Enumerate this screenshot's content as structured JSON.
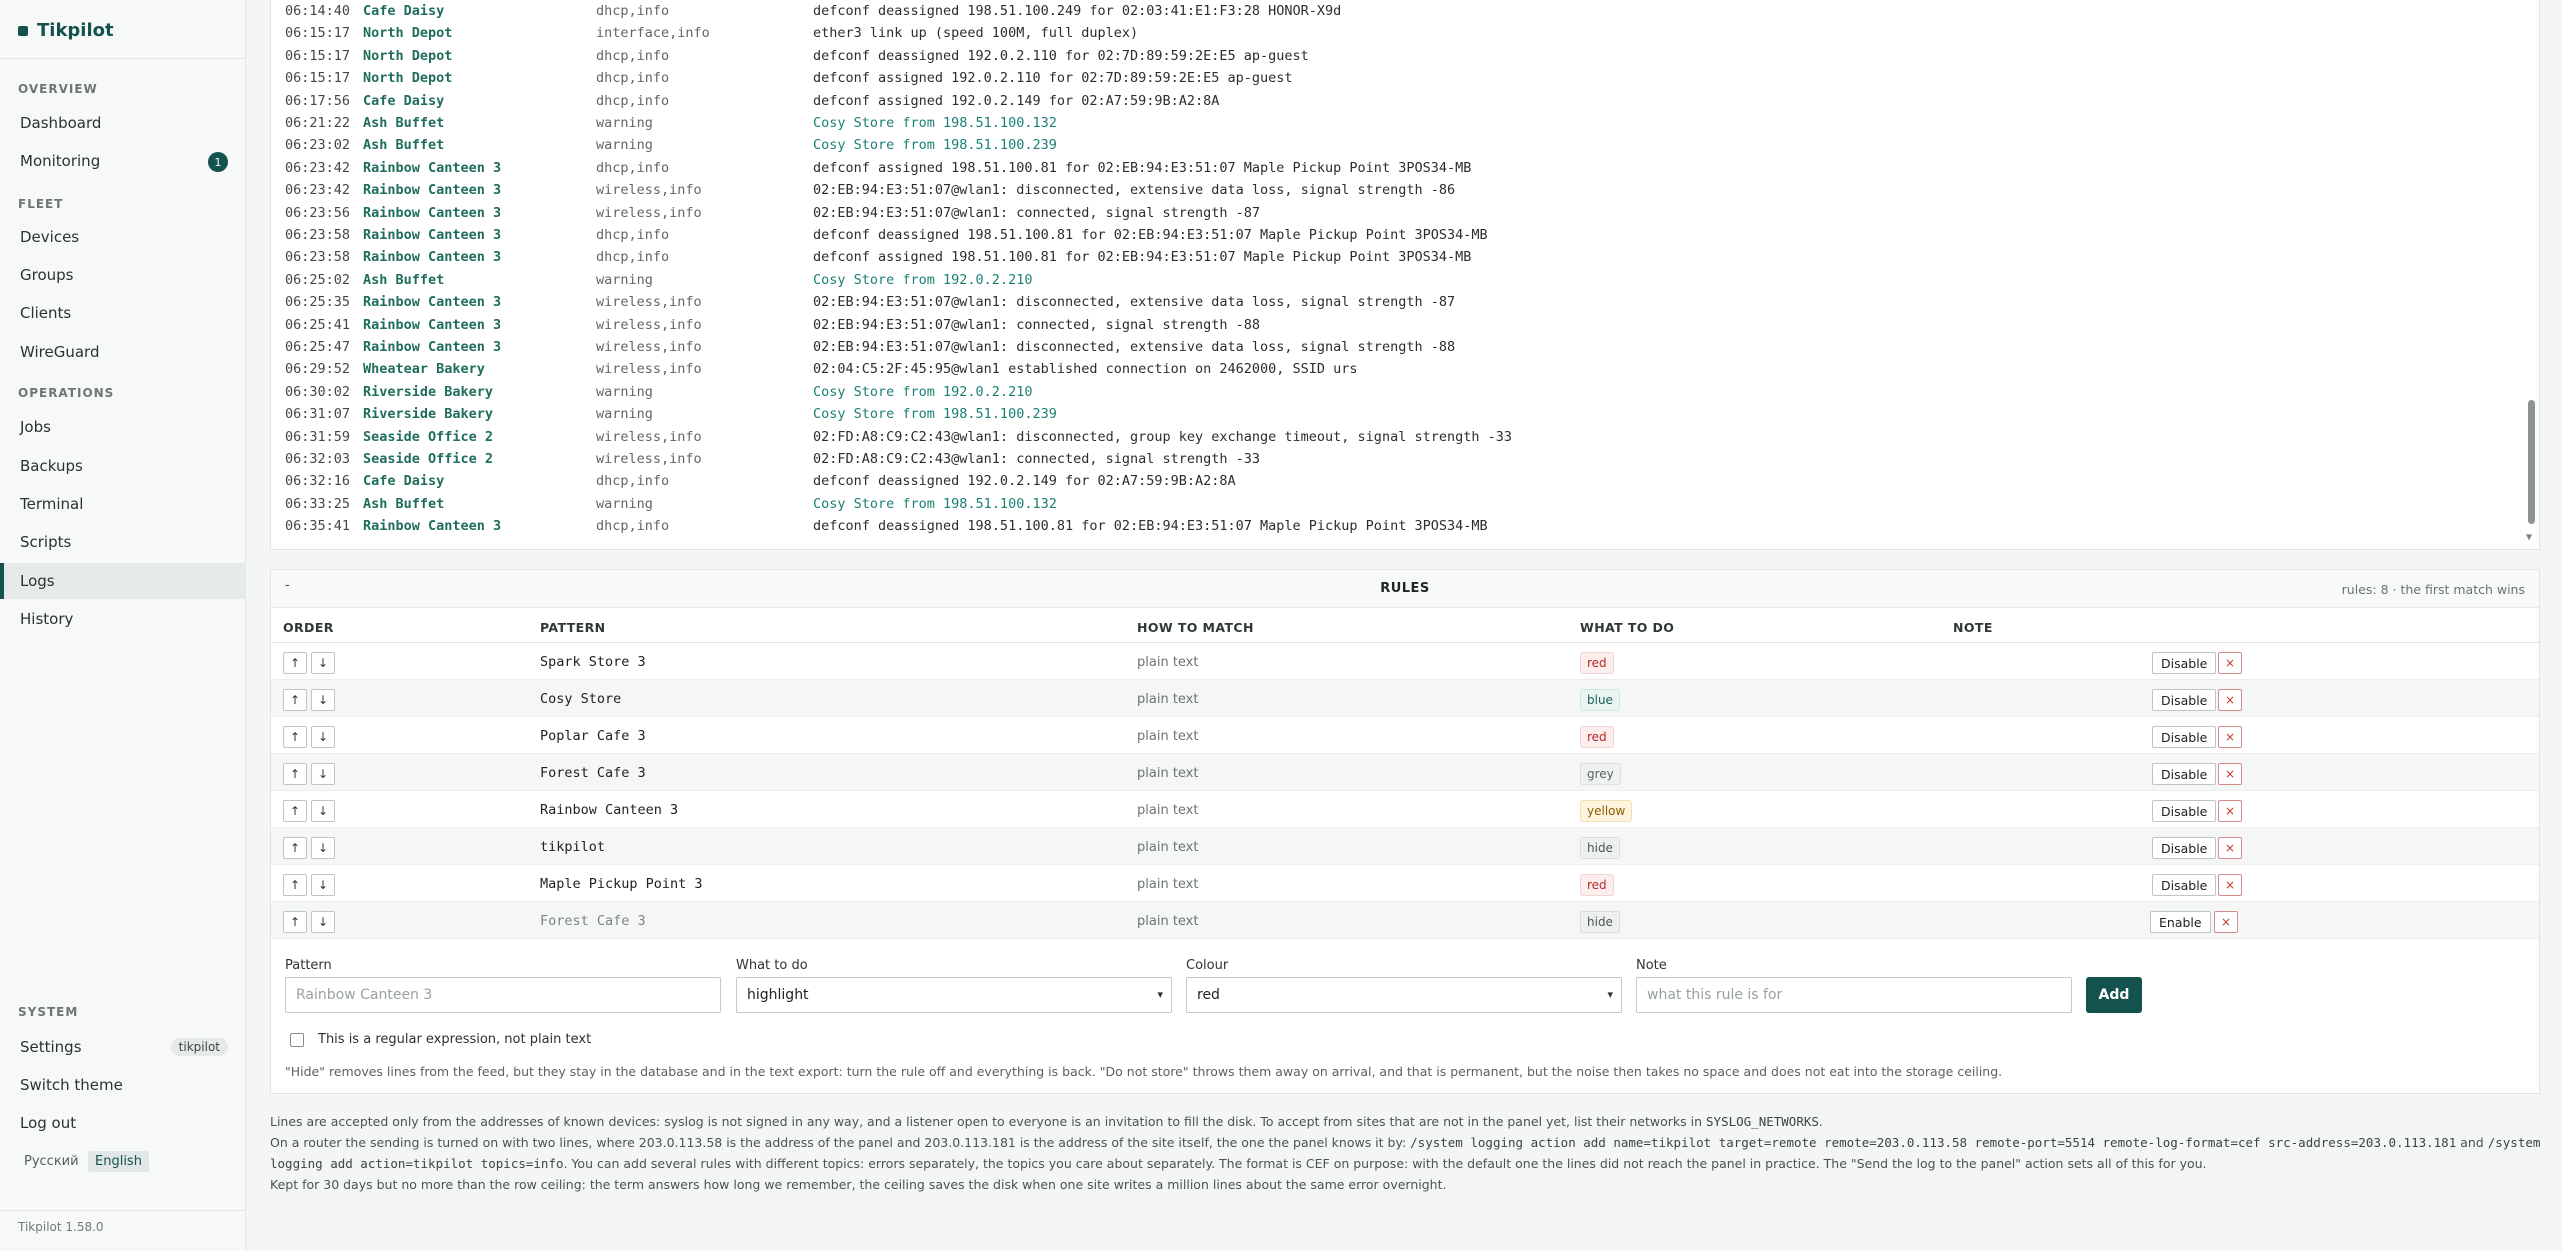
{
  "app": {
    "name": "Tikpilot",
    "version": "Tikpilot 1.58.0"
  },
  "sidebar": {
    "sections": {
      "overview": "OVERVIEW",
      "fleet": "FLEET",
      "operations": "OPERATIONS",
      "system": "SYSTEM"
    },
    "items": {
      "dashboard": "Dashboard",
      "monitoring": "Monitoring",
      "monitoring_badge": "1",
      "devices": "Devices",
      "groups": "Groups",
      "clients": "Clients",
      "wireguard": "WireGuard",
      "jobs": "Jobs",
      "backups": "Backups",
      "terminal": "Terminal",
      "scripts": "Scripts",
      "logs": "Logs",
      "history": "History",
      "settings": "Settings",
      "settings_user": "tikpilot",
      "switch_theme": "Switch theme",
      "log_out": "Log out"
    },
    "languages": {
      "ru": "Русский",
      "en": "English"
    }
  },
  "log": [
    {
      "time": "06:14:40",
      "device": "Cafe Daisy",
      "topics": "dhcp,info",
      "message": "defconf deassigned 198.51.100.249 for 02:03:41:E1:F3:28 HONOR-X9d",
      "highlight": false
    },
    {
      "time": "06:15:17",
      "device": "North Depot",
      "topics": "interface,info",
      "message": "ether3 link up (speed 100M, full duplex)",
      "highlight": false
    },
    {
      "time": "06:15:17",
      "device": "North Depot",
      "topics": "dhcp,info",
      "message": "defconf deassigned 192.0.2.110 for 02:7D:89:59:2E:E5 ap-guest",
      "highlight": false
    },
    {
      "time": "06:15:17",
      "device": "North Depot",
      "topics": "dhcp,info",
      "message": "defconf assigned 192.0.2.110 for 02:7D:89:59:2E:E5 ap-guest",
      "highlight": false
    },
    {
      "time": "06:17:56",
      "device": "Cafe Daisy",
      "topics": "dhcp,info",
      "message": "defconf assigned 192.0.2.149 for 02:A7:59:9B:A2:8A",
      "highlight": false
    },
    {
      "time": "06:21:22",
      "device": "Ash Buffet",
      "topics": "warning",
      "message": "Cosy Store from 198.51.100.132",
      "highlight": true
    },
    {
      "time": "06:23:02",
      "device": "Ash Buffet",
      "topics": "warning",
      "message": "Cosy Store from 198.51.100.239",
      "highlight": true
    },
    {
      "time": "06:23:42",
      "device": "Rainbow Canteen 3",
      "topics": "dhcp,info",
      "message": "defconf assigned 198.51.100.81 for 02:EB:94:E3:51:07 Maple Pickup Point 3POS34-MB",
      "highlight": false
    },
    {
      "time": "06:23:42",
      "device": "Rainbow Canteen 3",
      "topics": "wireless,info",
      "message": "02:EB:94:E3:51:07@wlan1: disconnected, extensive data loss, signal strength -86",
      "highlight": false
    },
    {
      "time": "06:23:56",
      "device": "Rainbow Canteen 3",
      "topics": "wireless,info",
      "message": "02:EB:94:E3:51:07@wlan1: connected, signal strength -87",
      "highlight": false
    },
    {
      "time": "06:23:58",
      "device": "Rainbow Canteen 3",
      "topics": "dhcp,info",
      "message": "defconf deassigned 198.51.100.81 for 02:EB:94:E3:51:07 Maple Pickup Point 3POS34-MB",
      "highlight": false
    },
    {
      "time": "06:23:58",
      "device": "Rainbow Canteen 3",
      "topics": "dhcp,info",
      "message": "defconf assigned 198.51.100.81 for 02:EB:94:E3:51:07 Maple Pickup Point 3POS34-MB",
      "highlight": false
    },
    {
      "time": "06:25:02",
      "device": "Ash Buffet",
      "topics": "warning",
      "message": "Cosy Store from 192.0.2.210",
      "highlight": true
    },
    {
      "time": "06:25:35",
      "device": "Rainbow Canteen 3",
      "topics": "wireless,info",
      "message": "02:EB:94:E3:51:07@wlan1: disconnected, extensive data loss, signal strength -87",
      "highlight": false
    },
    {
      "time": "06:25:41",
      "device": "Rainbow Canteen 3",
      "topics": "wireless,info",
      "message": "02:EB:94:E3:51:07@wlan1: connected, signal strength -88",
      "highlight": false
    },
    {
      "time": "06:25:47",
      "device": "Rainbow Canteen 3",
      "topics": "wireless,info",
      "message": "02:EB:94:E3:51:07@wlan1: disconnected, extensive data loss, signal strength -88",
      "highlight": false
    },
    {
      "time": "06:29:52",
      "device": "Wheatear Bakery",
      "topics": "wireless,info",
      "message": "02:04:C5:2F:45:95@wlan1 established connection on 2462000, SSID urs",
      "highlight": false
    },
    {
      "time": "06:30:02",
      "device": "Riverside Bakery",
      "topics": "warning",
      "message": "Cosy Store from 192.0.2.210",
      "highlight": true
    },
    {
      "time": "06:31:07",
      "device": "Riverside Bakery",
      "topics": "warning",
      "message": "Cosy Store from 198.51.100.239",
      "highlight": true
    },
    {
      "time": "06:31:59",
      "device": "Seaside Office 2",
      "topics": "wireless,info",
      "message": "02:FD:A8:C9:C2:43@wlan1: disconnected, group key exchange timeout, signal strength -33",
      "highlight": false
    },
    {
      "time": "06:32:03",
      "device": "Seaside Office 2",
      "topics": "wireless,info",
      "message": "02:FD:A8:C9:C2:43@wlan1: connected, signal strength -33",
      "highlight": false
    },
    {
      "time": "06:32:16",
      "device": "Cafe Daisy",
      "topics": "dhcp,info",
      "message": "defconf deassigned 192.0.2.149 for 02:A7:59:9B:A2:8A",
      "highlight": false
    },
    {
      "time": "06:33:25",
      "device": "Ash Buffet",
      "topics": "warning",
      "message": "Cosy Store from 198.51.100.132",
      "highlight": true
    },
    {
      "time": "06:35:41",
      "device": "Rainbow Canteen 3",
      "topics": "dhcp,info",
      "message": "defconf deassigned 198.51.100.81 for 02:EB:94:E3:51:07 Maple Pickup Point 3POS34-MB",
      "highlight": false
    }
  ],
  "rules": {
    "collapse_glyph": "-",
    "title": "RULES",
    "meta": "rules: 8 · the first match wins",
    "headers": {
      "order": "ORDER",
      "pattern": "PATTERN",
      "how": "HOW TO MATCH",
      "what": "WHAT TO DO",
      "note": "NOTE"
    },
    "up_glyph": "↑",
    "down_glyph": "↓",
    "delete_glyph": "×",
    "rows": [
      {
        "pattern": "Spark Store 3",
        "match": "plain text",
        "action": "red",
        "badge": "red",
        "toggle": "Disable",
        "disabled": false
      },
      {
        "pattern": "Cosy Store",
        "match": "plain text",
        "action": "blue",
        "badge": "blue",
        "toggle": "Disable",
        "disabled": false
      },
      {
        "pattern": "Poplar Cafe 3",
        "match": "plain text",
        "action": "red",
        "badge": "red",
        "toggle": "Disable",
        "disabled": false
      },
      {
        "pattern": "Forest Cafe 3",
        "match": "plain text",
        "action": "grey",
        "badge": "grey",
        "toggle": "Disable",
        "disabled": false
      },
      {
        "pattern": "Rainbow Canteen 3",
        "match": "plain text",
        "action": "yellow",
        "badge": "yellow",
        "toggle": "Disable",
        "disabled": false
      },
      {
        "pattern": "tikpilot",
        "match": "plain text",
        "action": "hide",
        "badge": "hide",
        "toggle": "Disable",
        "disabled": false
      },
      {
        "pattern": "Maple Pickup Point 3",
        "match": "plain text",
        "action": "red",
        "badge": "red",
        "toggle": "Disable",
        "disabled": false
      },
      {
        "pattern": "Forest Cafe 3",
        "match": "plain text",
        "action": "hide",
        "badge": "hide",
        "toggle": "Enable",
        "disabled": true
      }
    ]
  },
  "form": {
    "pattern_label": "Pattern",
    "pattern_placeholder": "Rainbow Canteen 3",
    "what_label": "What to do",
    "what_value": "highlight",
    "colour_label": "Colour",
    "colour_value": "red",
    "note_label": "Note",
    "note_placeholder": "what this rule is for",
    "add_label": "Add",
    "regex_label": "This is a regular expression, not plain text",
    "hint": "\"Hide\" removes lines from the feed, but they stay in the database and in the text export: turn the rule off and everything is back. \"Do not store\" throws them away on arrival, and that is permanent, but the noise then takes no space and does not eat into the storage ceiling."
  },
  "info": {
    "line1_a": "Lines are accepted only from the addresses of known devices: syslog is not signed in any way, and a listener open to everyone is an invitation to fill the disk. To accept from sites that are not in the panel yet, list their networks in",
    "line1_code": "SYSLOG_NETWORKS",
    "line1_b": ".",
    "line2_a": "On a router the sending is turned on with two lines, where 203.0.113.58 is the address of the panel and 203.0.113.181 is the address of the site itself, the one the panel knows it by:",
    "line2_code1": "/system logging action add name=tikpilot target=remote remote=203.0.113.58 remote-port=5514 remote-log-format=cef src-address=203.0.113.181",
    "line2_b": "and",
    "line2_code2": "/system",
    "line3_code": "logging add action=tikpilot topics=info",
    "line3_b": ". You can add several rules with different topics: errors separately, the topics you care about separately. The format is CEF on purpose: with the default one the lines did not reach the panel in practice. The \"Send the log to the panel\" action sets all of this for you.",
    "line4": "Kept for 30 days but no more than the row ceiling: the term answers how long we remember, the ceiling saves the disk when one site writes a million lines about the same error overnight."
  },
  "colors": {
    "accent": "#14524e",
    "highlight_text": "#1b8074",
    "device_text": "#1f6d5c",
    "danger": "#c0392b"
  }
}
